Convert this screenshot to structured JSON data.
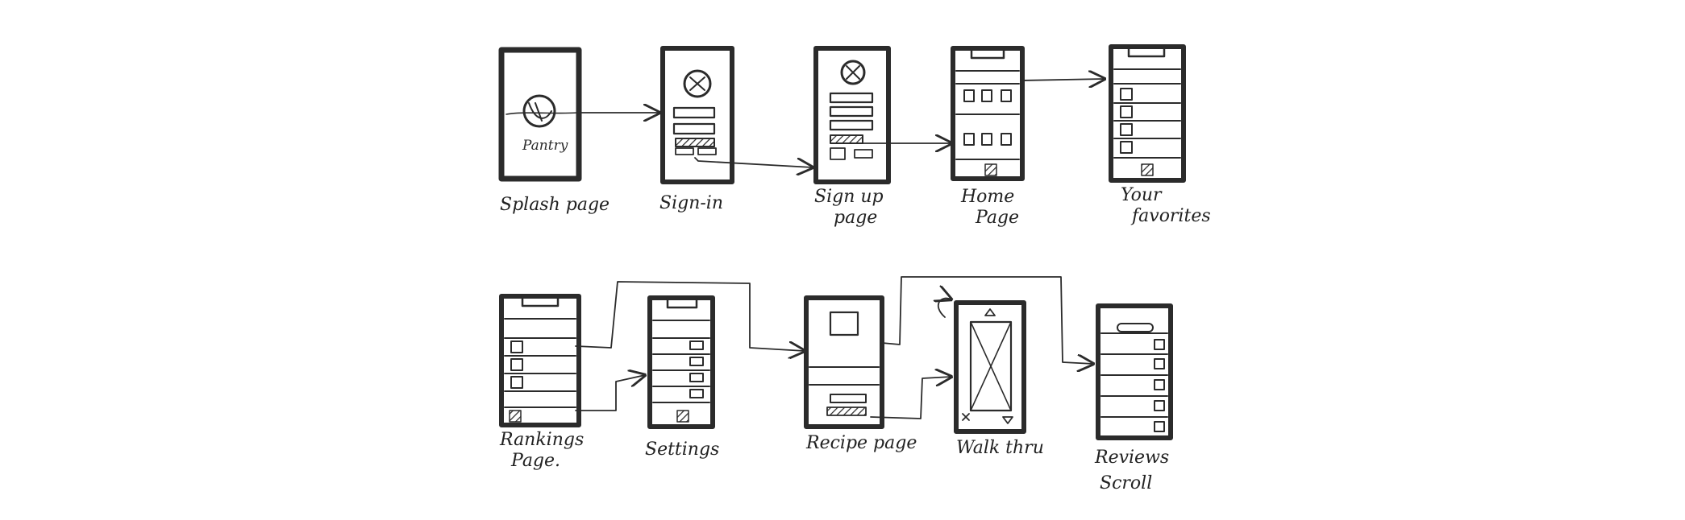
{
  "colors": {
    "ink": "#2b2b2b",
    "paper": "#ffffff"
  },
  "screens": [
    {
      "id": "splash",
      "label": [
        "Splash page"
      ],
      "logo_text": "Pantry"
    },
    {
      "id": "sign-in",
      "label": [
        "Sign-in"
      ]
    },
    {
      "id": "sign-up",
      "label": [
        "Sign up",
        "page"
      ]
    },
    {
      "id": "home",
      "label": [
        "Home",
        "Page"
      ]
    },
    {
      "id": "favorites",
      "label": [
        "Your",
        "favorites"
      ]
    },
    {
      "id": "rankings",
      "label": [
        "Rankings",
        "Page."
      ]
    },
    {
      "id": "settings",
      "label": [
        "Settings"
      ]
    },
    {
      "id": "recipe",
      "label": [
        "Recipe page"
      ]
    },
    {
      "id": "walkthrough",
      "label": [
        "Walk thru"
      ]
    },
    {
      "id": "reviews",
      "label": [
        "Reviews",
        "Scroll"
      ]
    }
  ]
}
